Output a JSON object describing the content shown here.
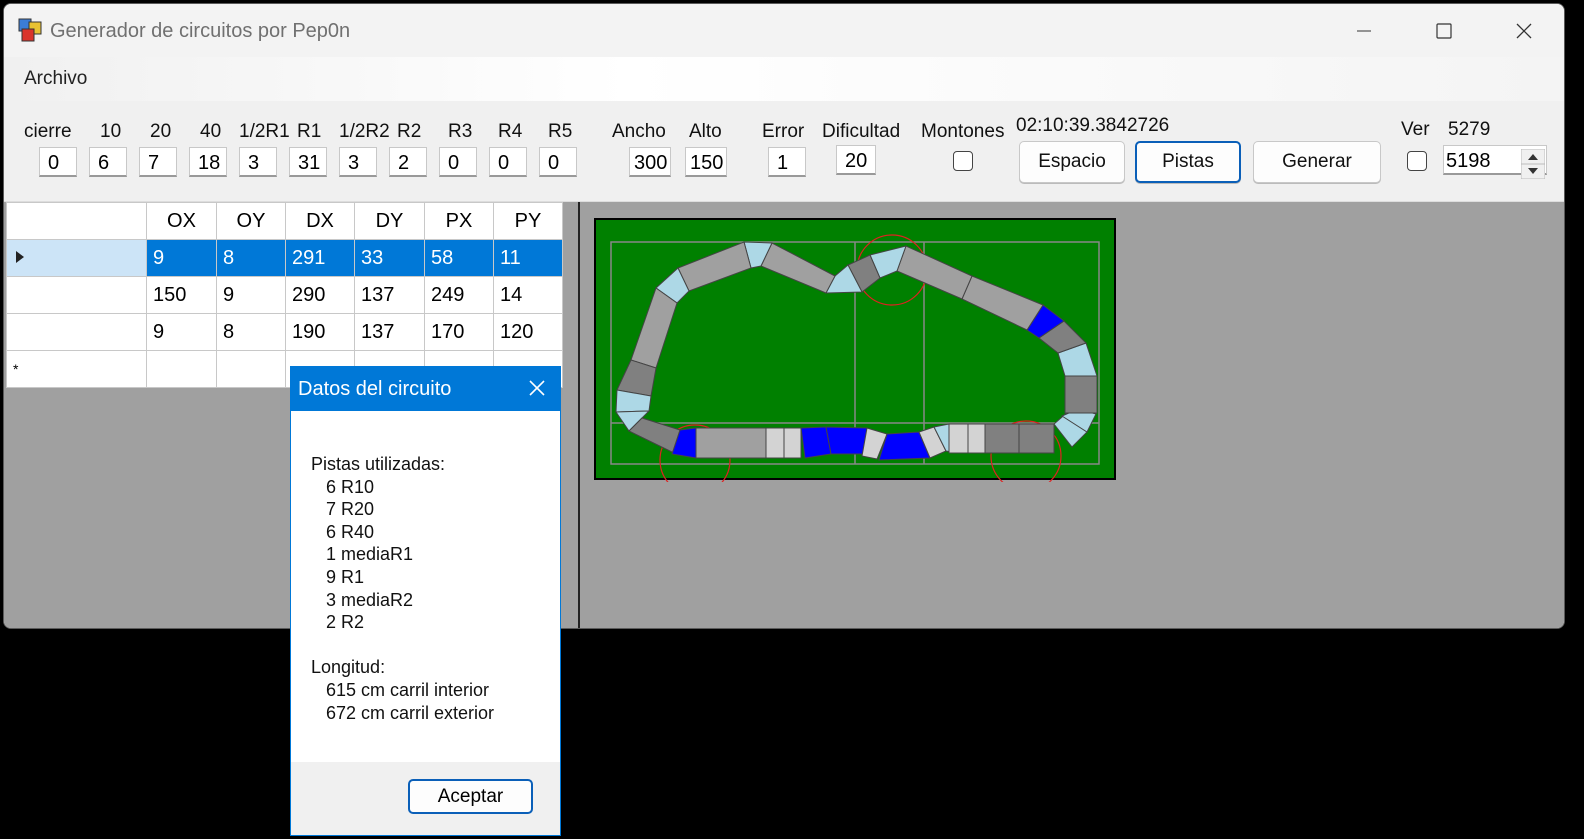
{
  "window": {
    "title": "Generador de circuitos por Pep0n"
  },
  "menu": {
    "archivo": "Archivo"
  },
  "toolbar": {
    "fields": [
      {
        "label": "cierre",
        "value": "0"
      },
      {
        "label": "10",
        "value": "6"
      },
      {
        "label": "20",
        "value": "7"
      },
      {
        "label": "40",
        "value": "18"
      },
      {
        "label": "1/2R1",
        "value": "3"
      },
      {
        "label": "R1",
        "value": "31"
      },
      {
        "label": "1/2R2",
        "value": "3"
      },
      {
        "label": "R2",
        "value": "2"
      },
      {
        "label": "R3",
        "value": "0"
      },
      {
        "label": "R4",
        "value": "0"
      },
      {
        "label": "R5",
        "value": "0"
      }
    ],
    "ancho_label": "Ancho",
    "ancho_value": "300",
    "alto_label": "Alto",
    "alto_value": "150",
    "error_label": "Error",
    "error_value": "1",
    "dificultad_label": "Dificultad",
    "dificultad_value": "20",
    "montones_label": "Montones",
    "timer": "02:10:39.3842726",
    "espacio_button": "Espacio",
    "pistas_button": "Pistas",
    "generar_button": "Generar",
    "ver_label": "Ver",
    "ver_count": "5279",
    "seed_value": "5198"
  },
  "grid": {
    "columns": [
      "OX",
      "OY",
      "DX",
      "DY",
      "PX",
      "PY"
    ],
    "rows": [
      [
        "9",
        "8",
        "291",
        "33",
        "58",
        "11"
      ],
      [
        "150",
        "9",
        "290",
        "137",
        "249",
        "14"
      ],
      [
        "9",
        "8",
        "190",
        "137",
        "170",
        "120"
      ]
    ],
    "new_row_marker": "*"
  },
  "dialog": {
    "title": "Datos del circuito",
    "pistas_header": "Pistas utilizadas:",
    "pistas": [
      "6 R10",
      "7 R20",
      "6 R40",
      "1 mediaR1",
      "9 R1",
      "3 mediaR2",
      "2 R2"
    ],
    "longitud_header": "Longitud:",
    "longitud": [
      "615 cm carril interior",
      "672 cm carril exterior"
    ],
    "ok_button": "Aceptar"
  },
  "colors": {
    "accent": "#0078d7",
    "board_green": "#008000",
    "track_gray": "#a0a0a0",
    "track_dark": "#808080",
    "track_light_blue": "#add8e6",
    "track_blue": "#0000ff"
  }
}
